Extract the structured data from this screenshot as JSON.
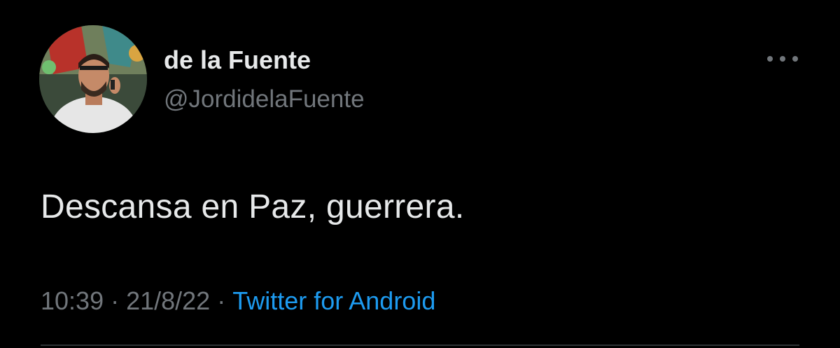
{
  "tweet": {
    "author_name": "de la Fuente",
    "author_handle": "@JordidelaFuente",
    "text": "Descansa en Paz, guerrera.",
    "time": "10:39",
    "date": "21/8/22",
    "separator": "·",
    "source": "Twitter for Android"
  },
  "icons": {
    "more": "more-horizontal-icon"
  },
  "colors": {
    "background": "#000000",
    "primary_text": "#e7e9ea",
    "secondary_text": "#71767b",
    "link": "#1d9bf0"
  }
}
